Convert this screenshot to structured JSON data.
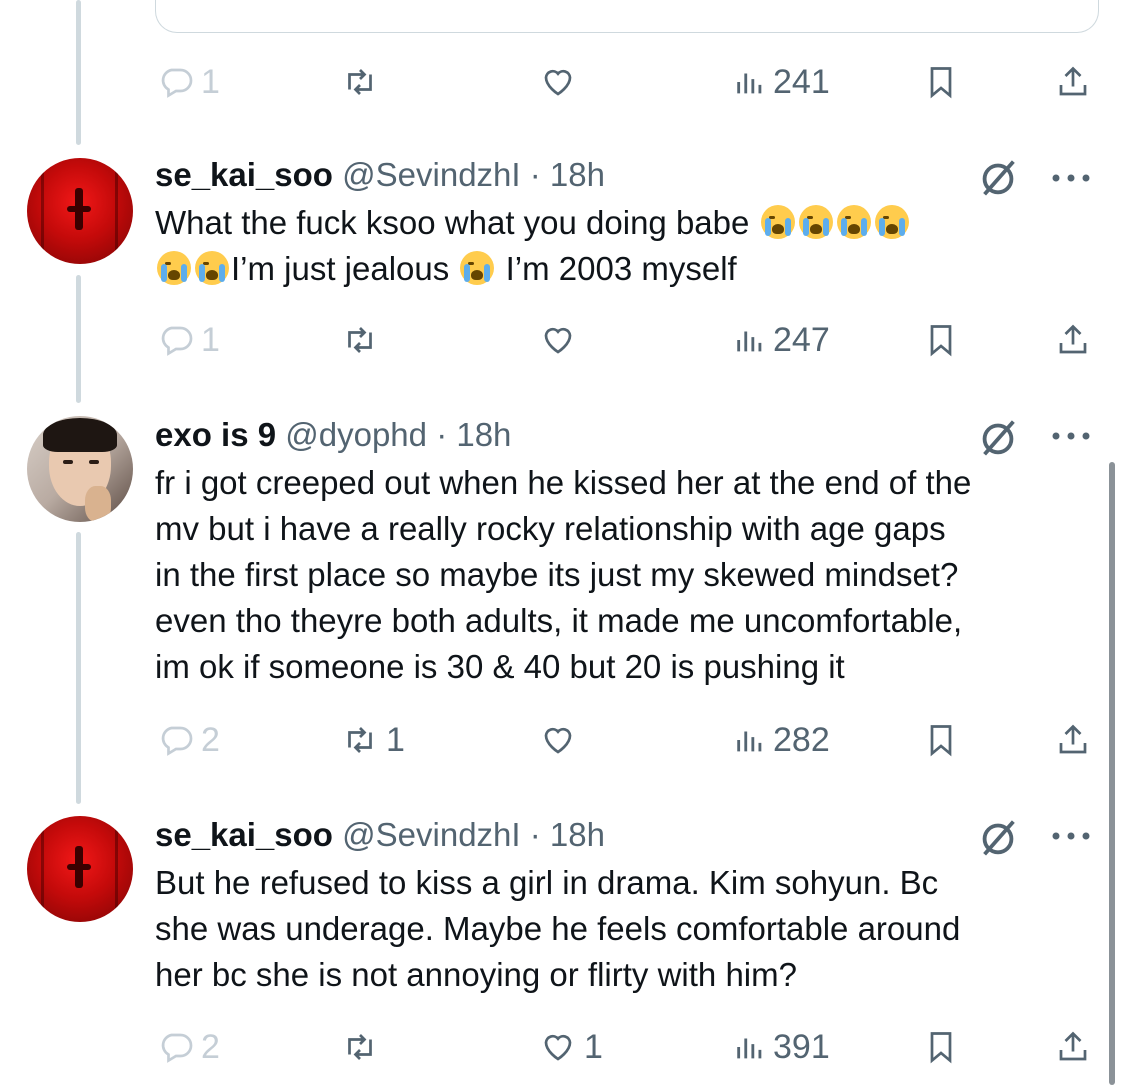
{
  "tweets": [
    {
      "name": "se_kai_soo",
      "handle": "@SevindzhI",
      "time": "· 18h",
      "lines": [
        "What the fuck ksoo what you doing babe",
        "I’m just jealous",
        "I’m 2003 myself"
      ],
      "replies": "1",
      "retweets": "",
      "likes": "",
      "views": "247"
    },
    {
      "name": "exo is 9",
      "handle": "@dyophd",
      "time": "· 18h",
      "lines": [
        "fr i got creeped out when he kissed her at the end of the",
        "mv but i have a really rocky relationship with age gaps",
        "in the first place so maybe its just my skewed mindset?",
        "even tho theyre both adults, it made me uncomfortable,",
        "im ok if someone is 30 & 40 but 20 is pushing it"
      ],
      "replies": "2",
      "retweets": "1",
      "likes": "",
      "views": "282"
    },
    {
      "name": "se_kai_soo",
      "handle": "@SevindzhI",
      "time": "· 18h",
      "lines": [
        "But he refused to kiss a girl in drama. Kim sohyun. Bc",
        "she was underage. Maybe he feels comfortable around",
        "her bc she is not annoying or flirty with him?"
      ],
      "replies": "2",
      "retweets": "",
      "likes": "1",
      "views": "391"
    }
  ],
  "top_actions": {
    "replies": "1",
    "views": "241"
  },
  "icons": {
    "reply": "reply-icon",
    "retweet": "retweet-icon",
    "like": "heart-icon",
    "views": "views-icon",
    "bookmark": "bookmark-icon",
    "share": "share-icon",
    "grok": "grok-icon",
    "more": "more-icon",
    "emoji": "loudly-crying-face-emoji"
  },
  "colors": {
    "muted": "#536471",
    "faded": "#c5ced6",
    "thread": "#cfd9de",
    "text": "#0f1419"
  }
}
